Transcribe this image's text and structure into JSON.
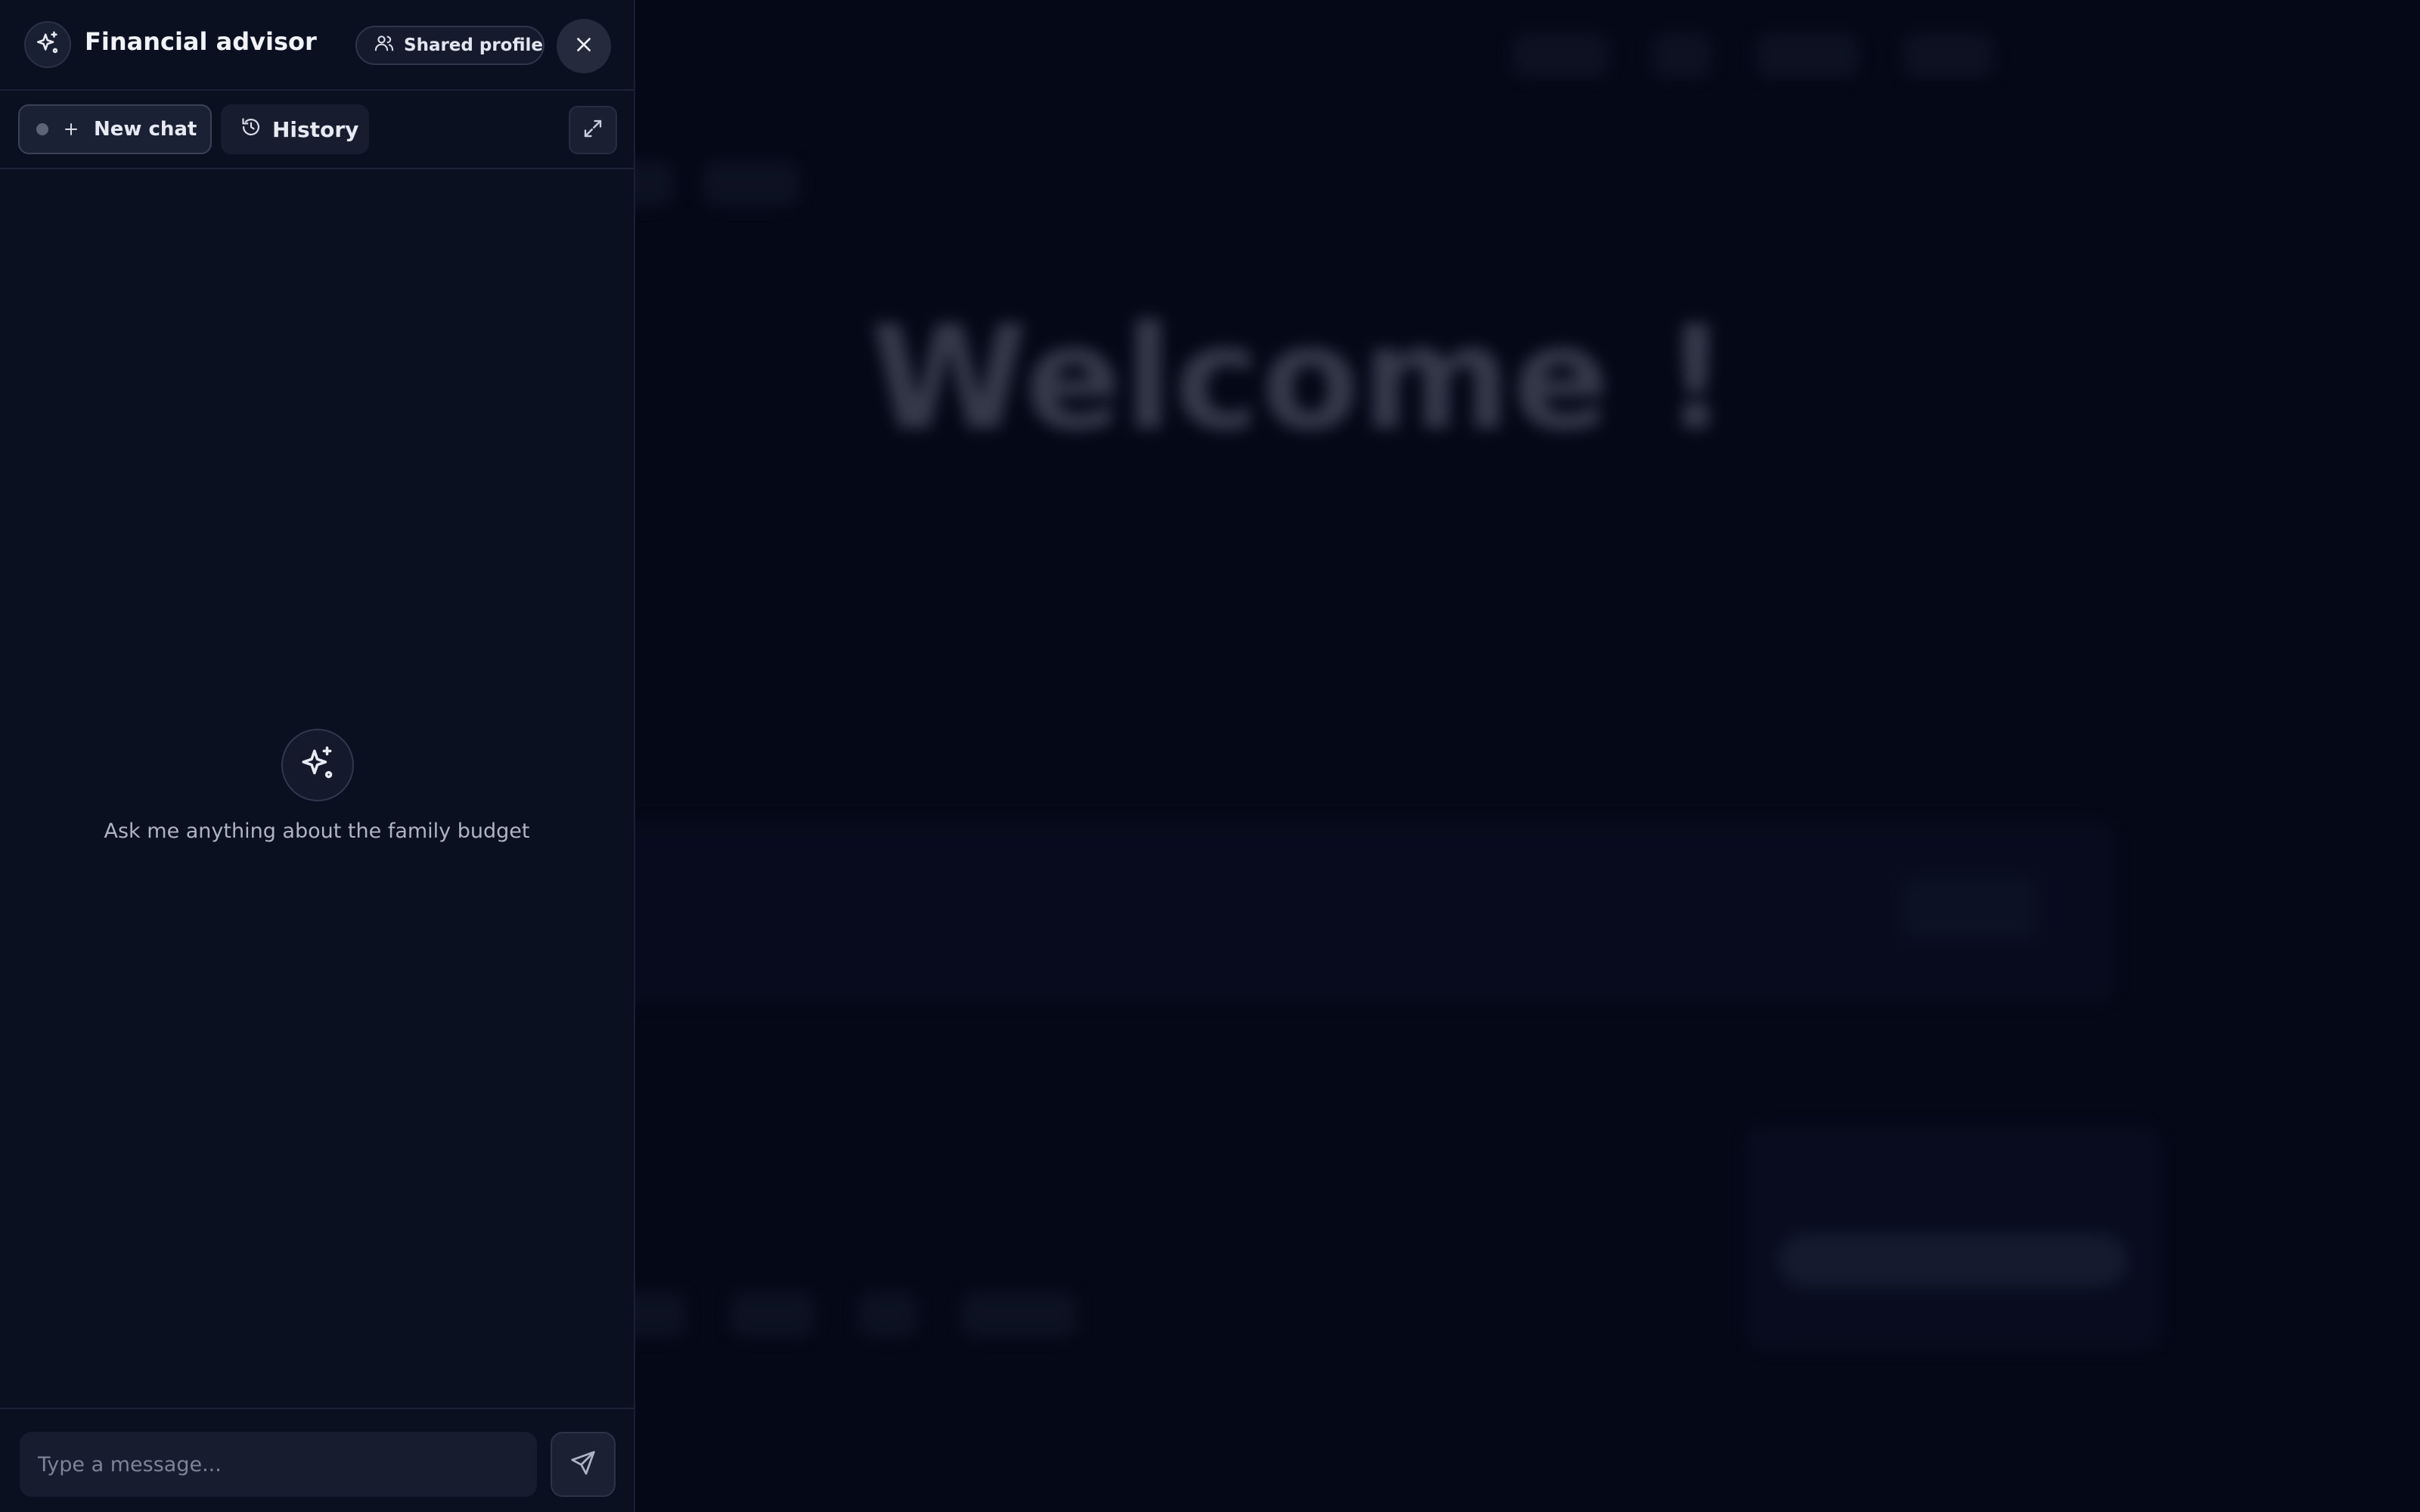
{
  "panel": {
    "title": "Financial advisor",
    "shared_profile_label": "Shared profile",
    "new_chat_label": "New chat",
    "history_label": "History",
    "empty_state_text": "Ask me anything about the family budget",
    "composer": {
      "placeholder": "Type a message..."
    },
    "icons": {
      "logo": "sparkles-icon",
      "shared": "users-icon",
      "close": "close-icon",
      "new_chat": "plus-icon",
      "history": "history-icon",
      "expand": "expand-icon",
      "empty": "sparkles-icon",
      "send": "send-icon"
    }
  },
  "background": {
    "welcome_text": "Welcome !"
  },
  "colors": {
    "panel_bg": "#0b1020",
    "page_bg": "#050817",
    "text_primary": "#f1f3f9",
    "text_muted": "#aeb4c4"
  }
}
